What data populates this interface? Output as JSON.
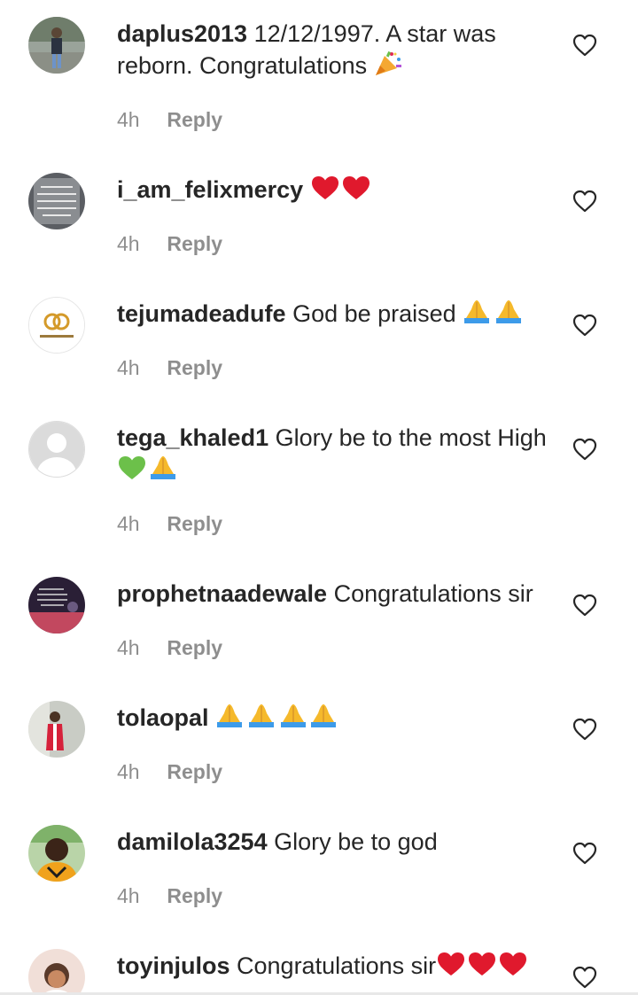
{
  "comments": [
    {
      "username": "daplus2013",
      "text": "12/12/1997. A star was reborn. Congratulations",
      "emoji": "party-popper-icon",
      "time": "4h",
      "reply_label": "Reply"
    },
    {
      "username": "i_am_felixmercy",
      "text": "",
      "emoji": "red-hearts-icon",
      "time": "4h",
      "reply_label": "Reply"
    },
    {
      "username": "tejumadeadufe",
      "text": "God be praised",
      "emoji": "praying-hands-icon",
      "time": "4h",
      "reply_label": "Reply"
    },
    {
      "username": "tega_khaled1",
      "text": "Glory be to the most High",
      "emoji": "green-heart-praying-hands-icon",
      "time": "4h",
      "reply_label": "Reply"
    },
    {
      "username": "prophetnaadewale",
      "text": "Congratulations sir",
      "emoji": "",
      "time": "4h",
      "reply_label": "Reply"
    },
    {
      "username": "tolaopal",
      "text": "",
      "emoji": "praying-hands-icon",
      "time": "4h",
      "reply_label": "Reply"
    },
    {
      "username": "damilola3254",
      "text": "Glory be to god",
      "emoji": "",
      "time": "4h",
      "reply_label": "Reply"
    },
    {
      "username": "toyinjulos",
      "text": "Congratulations sir",
      "emoji": "red-hearts-icon",
      "time": "",
      "reply_label": ""
    }
  ],
  "colors": {
    "text": "#262626",
    "meta": "#8e8e8e",
    "heart_red": "#e0192d",
    "green_heart": "#6cc04a",
    "hands_blue": "#3d9be9",
    "hands_skin": "#f5b92b"
  }
}
